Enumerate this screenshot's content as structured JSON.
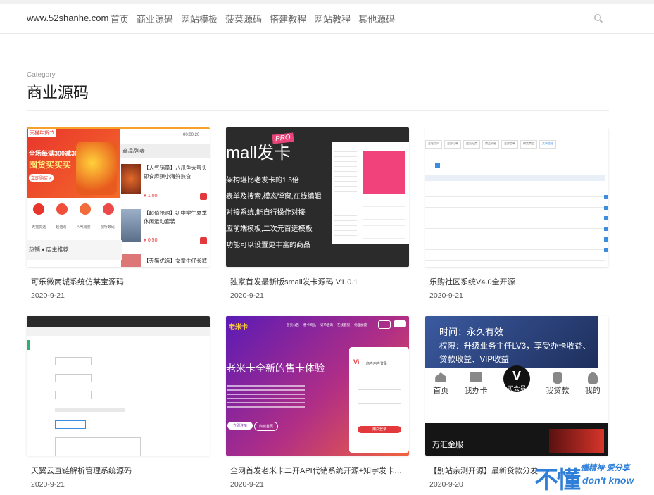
{
  "header": {
    "logo": "www.52shanhe.com",
    "nav": [
      "首页",
      "商业源码",
      "网站模板",
      "菠菜源码",
      "搭建教程",
      "网站教程",
      "其他源码"
    ]
  },
  "category": {
    "label": "Category",
    "title": "商业源码"
  },
  "posts": [
    {
      "title": "可乐微商城系统仿某宝源码",
      "date": "2020-9-21"
    },
    {
      "title": "独家首发最新版small发卡源码 V1.0.1",
      "date": "2020-9-21"
    },
    {
      "title": "乐购社区系统V4.0全开源",
      "date": "2020-9-21"
    },
    {
      "title": "天翼云直链解析管理系统源码",
      "date": "2020-9-21"
    },
    {
      "title": "全网首发老米卡二开API代销系统开源+知宇发卡系统...",
      "date": "2020-9-21"
    },
    {
      "title": "【别站亲测开源】最新贷款分发...",
      "date": "2020-9-20"
    }
  ],
  "thumbs": {
    "t1": {
      "badge": "天猫年货节",
      "promo1": "全场每满300减30",
      "promo2": "囤货买买买",
      "promo3": "立即购买 >",
      "list_title": "商品列表",
      "time": "00:00:20",
      "item1": "【人气销量】八爪鱼大蛋头即食麻辣小海鲜熟食",
      "price1": "¥ 1.00",
      "item2": "【超值抢购】初中学生夏季休闲运动套装",
      "price2": "¥ 0.50",
      "item3": "【天猫优选】女童牛仔长裤子",
      "icons": [
        "天猫优选",
        "超值购",
        "人气销量",
        "视听数码"
      ],
      "section": "热销 ♦ 店主推荐"
    },
    "t2": {
      "big": "mall发卡",
      "pro": "PRO",
      "lines": [
        "架构堪比老发卡的1.5倍",
        "表单及搜索,模态弹窗,在线编辑",
        "对接系统,能自行操作对接",
        "应前端模板,二次元首选模板",
        "功能可以设置更丰富的商品"
      ]
    },
    "t3": {
      "tabs": [
        "全站用户",
        "全部订单",
        "会员分类",
        "商品卡密",
        "全部工单",
        "供货商品",
        "文章管理"
      ]
    },
    "t5": {
      "logo": "老米卡",
      "headline": "老米卡全新的售卡体验",
      "login": "商户用户登录",
      "btn1": "立即注册",
      "btn2": "商城首页",
      "submit": "用户登录",
      "menu": [
        "首页公告",
        "售卡商品",
        "订单查询",
        "在线客服",
        "代理加盟"
      ]
    },
    "t6": {
      "line1": "时间：永久有效",
      "line2": "权限：升级业务主任LV3，享受办卡收益、贷款收益、VIP收益",
      "tabs": [
        "首页",
        "我办卡",
        "买会员",
        "我贷款",
        "我的"
      ],
      "vip": "V",
      "bottom": "万汇金服"
    }
  },
  "watermark": {
    "main": "不懂",
    "top": "懂精神·爱分享",
    "bottom": "don't know"
  },
  "colors": {
    "accent": "#e4393c",
    "nav": "#666666"
  }
}
